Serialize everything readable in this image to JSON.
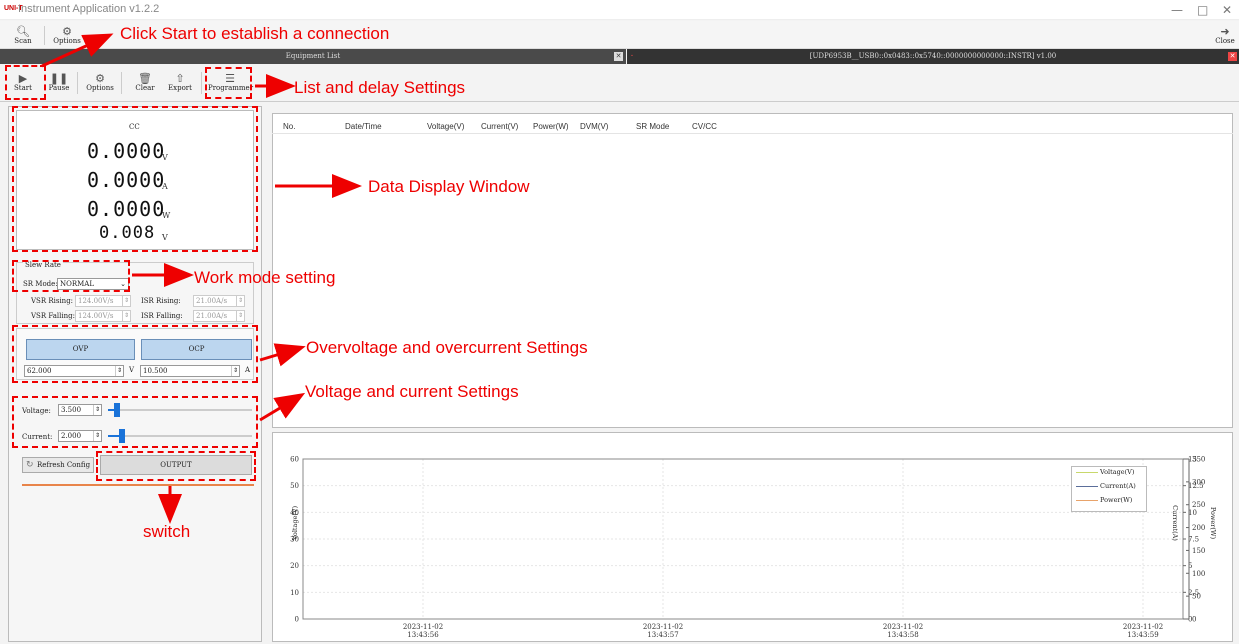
{
  "app": {
    "logo": "UNI-T",
    "title": "Instrument Application v1.2.2",
    "window_controls": {
      "minimize": "—",
      "restore": "□",
      "close": "✕"
    }
  },
  "top_toolbar": {
    "scan": "Scan",
    "options": "Options",
    "close": "Close"
  },
  "equipment_list_label": "Equipment List",
  "device_tab": "[UDP6953B__USB0::0x0483::0x5740::0000000000000::INSTR] v1.00",
  "device_toolbar": {
    "start": "Start",
    "pause": "Pause",
    "options": "Options",
    "clear": "Clear",
    "export": "Export",
    "programmer": "Programmer"
  },
  "readout": {
    "mode": "CC",
    "voltage": "0.0000",
    "voltage_unit": "V",
    "current": "0.0000",
    "current_unit": "A",
    "power": "0.0000",
    "power_unit": "W",
    "dvm": "0.008",
    "dvm_unit": "V"
  },
  "slew": {
    "group_title": "Slew Rate",
    "sr_mode_label": "SR Mode:",
    "sr_mode_value": "NORMAL",
    "vsr_rising_label": "VSR Rising:",
    "vsr_rising": "124.00V/s",
    "isr_rising_label": "ISR Rising:",
    "isr_rising": "21.00A/s",
    "vsr_falling_label": "VSR Falling:",
    "vsr_falling": "124.00V/s",
    "isr_falling_label": "ISR Falling:",
    "isr_falling": "21.00A/s"
  },
  "protection": {
    "ovp_label": "OVP",
    "ocp_label": "OCP",
    "ovp_value": "62.000",
    "ovp_unit": "V",
    "ocp_value": "10.500",
    "ocp_unit": "A"
  },
  "setpoints": {
    "voltage_label": "Voltage:",
    "voltage_value": "3.500",
    "voltage_fraction": 0.06,
    "current_label": "Current:",
    "current_value": "2.000",
    "current_fraction": 0.1
  },
  "refresh_config": "Refresh Config",
  "output": "OUTPUT",
  "table_headers": [
    "No.",
    "Date/Time",
    "Voltage(V)",
    "Current(V)",
    "Power(W)",
    "DVM(V)",
    "SR Mode",
    "CV/CC"
  ],
  "annotations": {
    "click_start": "Click Start to establish a connection",
    "list_delay": "List and delay Settings",
    "data_display": "Data Display Window",
    "work_mode": "Work mode setting",
    "ovp_ocp": "Overvoltage and overcurrent Settings",
    "voltage_current": "Voltage and current Settings",
    "switch": "switch"
  },
  "chart_data": {
    "type": "line",
    "ylabel": "Voltage(V)",
    "ylabel_right1": "Current(A)",
    "ylabel_right2": "Power(W)",
    "ylim": [
      0,
      60
    ],
    "ylim_right1": [
      0,
      15
    ],
    "ylim_right2": [
      0,
      350
    ],
    "yticks": [
      "0",
      "10",
      "20",
      "30",
      "40",
      "50",
      "60"
    ],
    "yticks_right1": [
      "0",
      "2.5",
      "5",
      "7.5",
      "10",
      "12.5",
      "15"
    ],
    "yticks_right2": [
      "0",
      "50",
      "100",
      "150",
      "200",
      "250",
      "300",
      "350"
    ],
    "x_ticks": [
      {
        "date": "2023-11-02",
        "time": "13:43:56"
      },
      {
        "date": "2023-11-02",
        "time": "13:43:57"
      },
      {
        "date": "2023-11-02",
        "time": "13:43:58"
      },
      {
        "date": "2023-11-02",
        "time": "13:43:59"
      }
    ],
    "series": [
      {
        "name": "Voltage(V)",
        "color": "#c8d86b",
        "values": []
      },
      {
        "name": "Current(A)",
        "color": "#5b6e9a",
        "values": []
      },
      {
        "name": "Power(W)",
        "color": "#e8a36a",
        "values": []
      }
    ],
    "grid": true,
    "legend": "top-right"
  },
  "colors": {
    "annotation": "#e00000",
    "button_blue": "#bcd6ef",
    "slider": "#1a73d9"
  }
}
